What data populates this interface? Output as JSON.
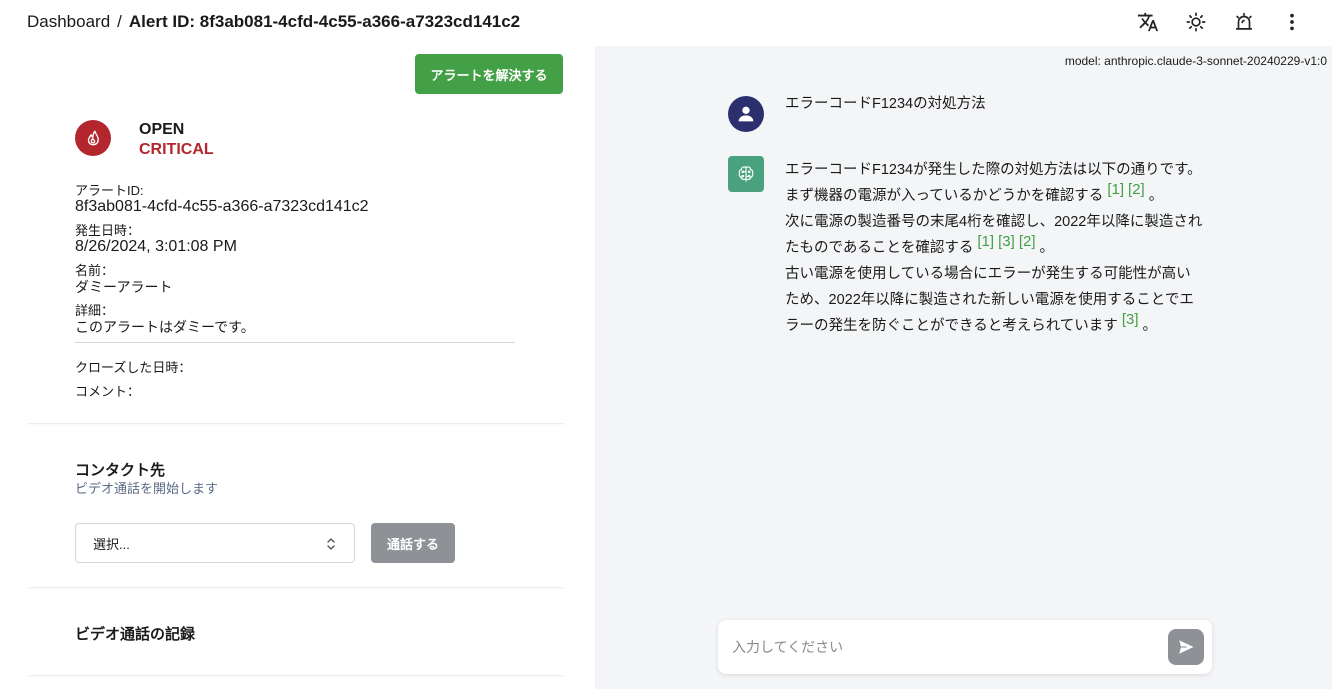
{
  "header": {
    "breadcrumb_root": "Dashboard",
    "breadcrumb_sep": "/",
    "breadcrumb_current": "Alert ID: 8f3ab081-4cfd-4c55-a366-a7323cd141c2",
    "icons": [
      "translate-icon",
      "theme-toggle-icon",
      "alarm-icon",
      "more-vert-icon"
    ]
  },
  "alert": {
    "resolve_button": "アラートを解決する",
    "status": "OPEN",
    "severity": "CRITICAL",
    "severity_color": "#b3262e",
    "id_label": "アラートID:",
    "id_value": "8f3ab081-4cfd-4c55-a366-a7323cd141c2",
    "date_label": "発生日時：",
    "date_value": "8/26/2024, 3:01:08 PM",
    "name_label": "名前：",
    "name_value": "ダミーアラート",
    "detail_label": "詳細：",
    "detail_value": "このアラートはダミーです。",
    "closed_label": "クローズした日時：",
    "comment_label": "コメント："
  },
  "contact": {
    "title": "コンタクト先",
    "subtitle": "ビデオ通話を開始します",
    "select_value": "選択...",
    "call_button": "通話する"
  },
  "records": {
    "title": "ビデオ通話の記録"
  },
  "chat": {
    "model": "model: anthropic.claude-3-sonnet-20240229-v1:0",
    "user_message": "エラーコードF1234の対処方法",
    "bot": {
      "line1": "エラーコードF1234が発生した際の対処方法は以下の通りです。",
      "line2": "まず機器の電源が入っているかどうかを確認する",
      "line2_cites": [
        "[1]",
        "[2]"
      ],
      "line3": "次に電源の製造番号の末尾4桁を確認し、2022年以降に製造されたものであることを確認する",
      "line3_cites": [
        "[1]",
        "[3]",
        "[2]"
      ],
      "line4": "古い電源を使用している場合にエラーが発生する可能性が高いため、2022年以降に製造された新しい電源を使用することでエラーの発生を防ぐことができると考えられています",
      "line4_cites": [
        "[3]"
      ],
      "period": "。"
    },
    "input_placeholder": "入力してください",
    "accent": "#43a047"
  }
}
